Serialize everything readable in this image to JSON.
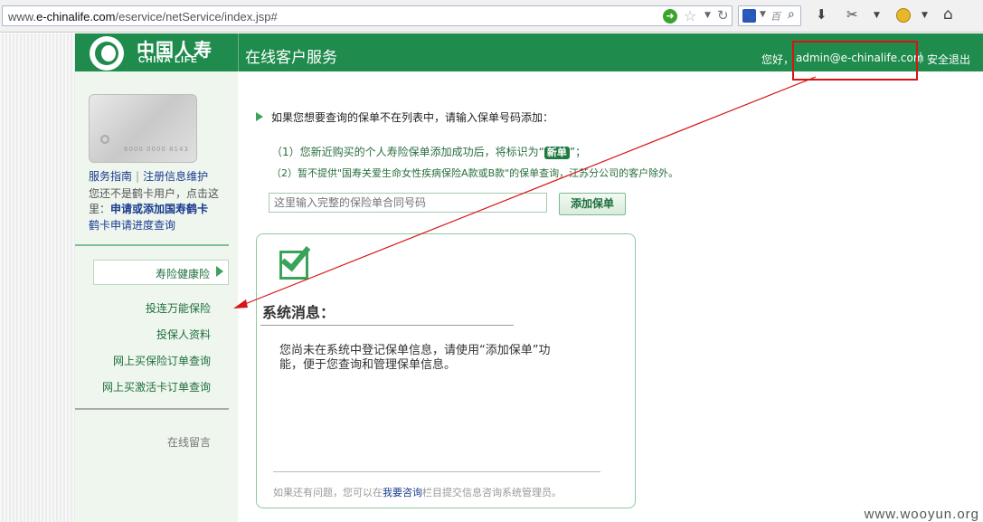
{
  "browser": {
    "url_prefix": "www.",
    "url_host": "e-chinalife.com",
    "url_path": "/eservice/netService/index.jsp#",
    "search_hint": "百"
  },
  "header": {
    "logo_cn": "中国人寿",
    "logo_en": "CHINA LIFE",
    "title": "在线客户服务",
    "greeting": "您好，",
    "username": "admin@e-chinalife.com",
    "separator": "|",
    "logout": "安全退出"
  },
  "sidebar": {
    "card_number": "6000 0000 8143",
    "guide_link": "服务指南",
    "link_sep": "|",
    "register_link": "注册信息维护",
    "note_text": "您还不是鹤卡用户，点击这里：",
    "apply_link": "申请或添加国寿鹤卡",
    "progress_link": "鹤卡申请进度查询",
    "menu": [
      {
        "label": "寿险健康险"
      },
      {
        "label": "投连万能保险"
      },
      {
        "label": "投保人资料"
      },
      {
        "label": "网上买保险订单查询"
      },
      {
        "label": "网上买激活卡订单查询"
      }
    ],
    "message_link": "在线留言"
  },
  "main": {
    "intro": "如果您想要查询的保单不在列表中，请输入保单号码添加：",
    "note1_prefix": "（1）您新近购买的个人寿险保单添加成功后，将标识为“",
    "new_badge": "新单",
    "note1_suffix": "”；",
    "note2": "（2）暂不提供\"国寿关爱生命女性疾病保险A款或B款\"的保单查询，江苏分公司的客户除外。",
    "input_placeholder": "这里输入完整的保险单合同号码",
    "add_button": "添加保单",
    "msg_title": "系统消息：",
    "msg_body": "您尚未在系统中登记保单信息，请使用“添加保单”功能，便于您查询和管理保单信息。",
    "footer_prefix": "如果还有问题，您可以在",
    "footer_link": "我要咨询",
    "footer_suffix": "栏目提交信息咨询系统管理员。"
  },
  "watermark": "www.wooyun.org",
  "colors": {
    "brand_green": "#1f8b4c",
    "annotation_red": "#d81414"
  }
}
